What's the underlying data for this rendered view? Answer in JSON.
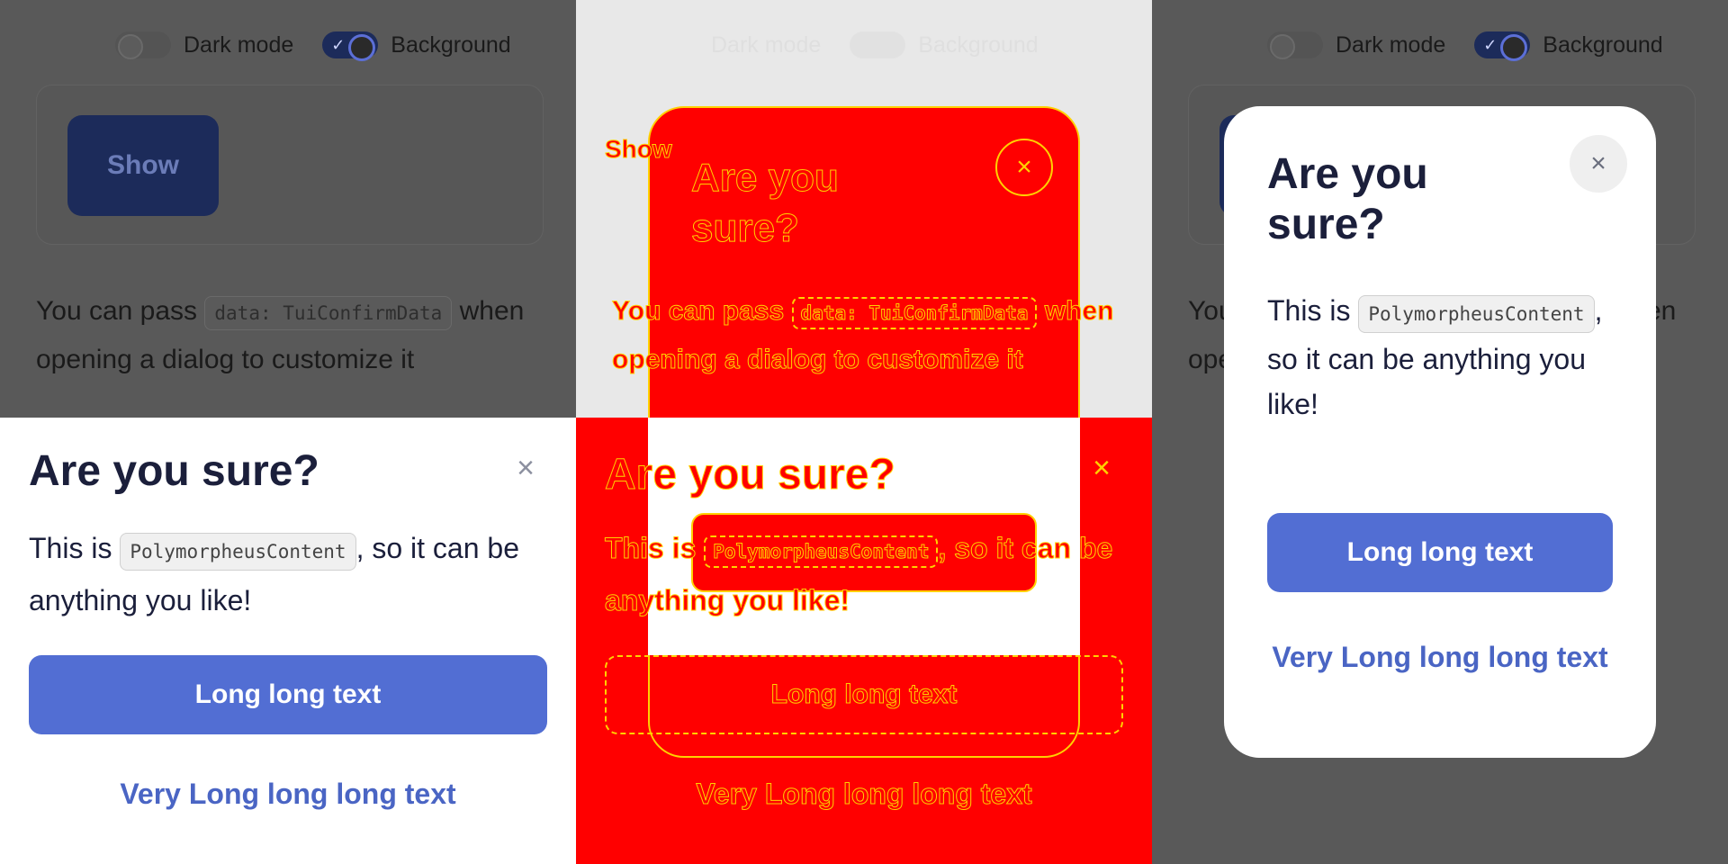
{
  "topbar": {
    "dark_mode_label": "Dark mode",
    "background_label": "Background"
  },
  "card": {
    "show_label": "Show"
  },
  "description": {
    "prefix": "You can pass",
    "code": "data: TuiConfirmData",
    "suffix": "when opening a dialog to customize it"
  },
  "dialog": {
    "title": "Are you sure?",
    "close_icon": "×",
    "body_prefix": "This is",
    "body_code": "PolymorpheusContent",
    "body_suffix": ", so it can be anything you like!",
    "primary_label": "Long long text",
    "secondary_label": "Very Long long long text"
  },
  "colors": {
    "overlay": "#595959",
    "primary": "#526ed3",
    "link": "#4a65c4",
    "toggle_on": "#1c2b5a",
    "glitch_fill": "#ff0000",
    "glitch_outline": "#ffd100",
    "light_bg": "#e8e8e8"
  }
}
